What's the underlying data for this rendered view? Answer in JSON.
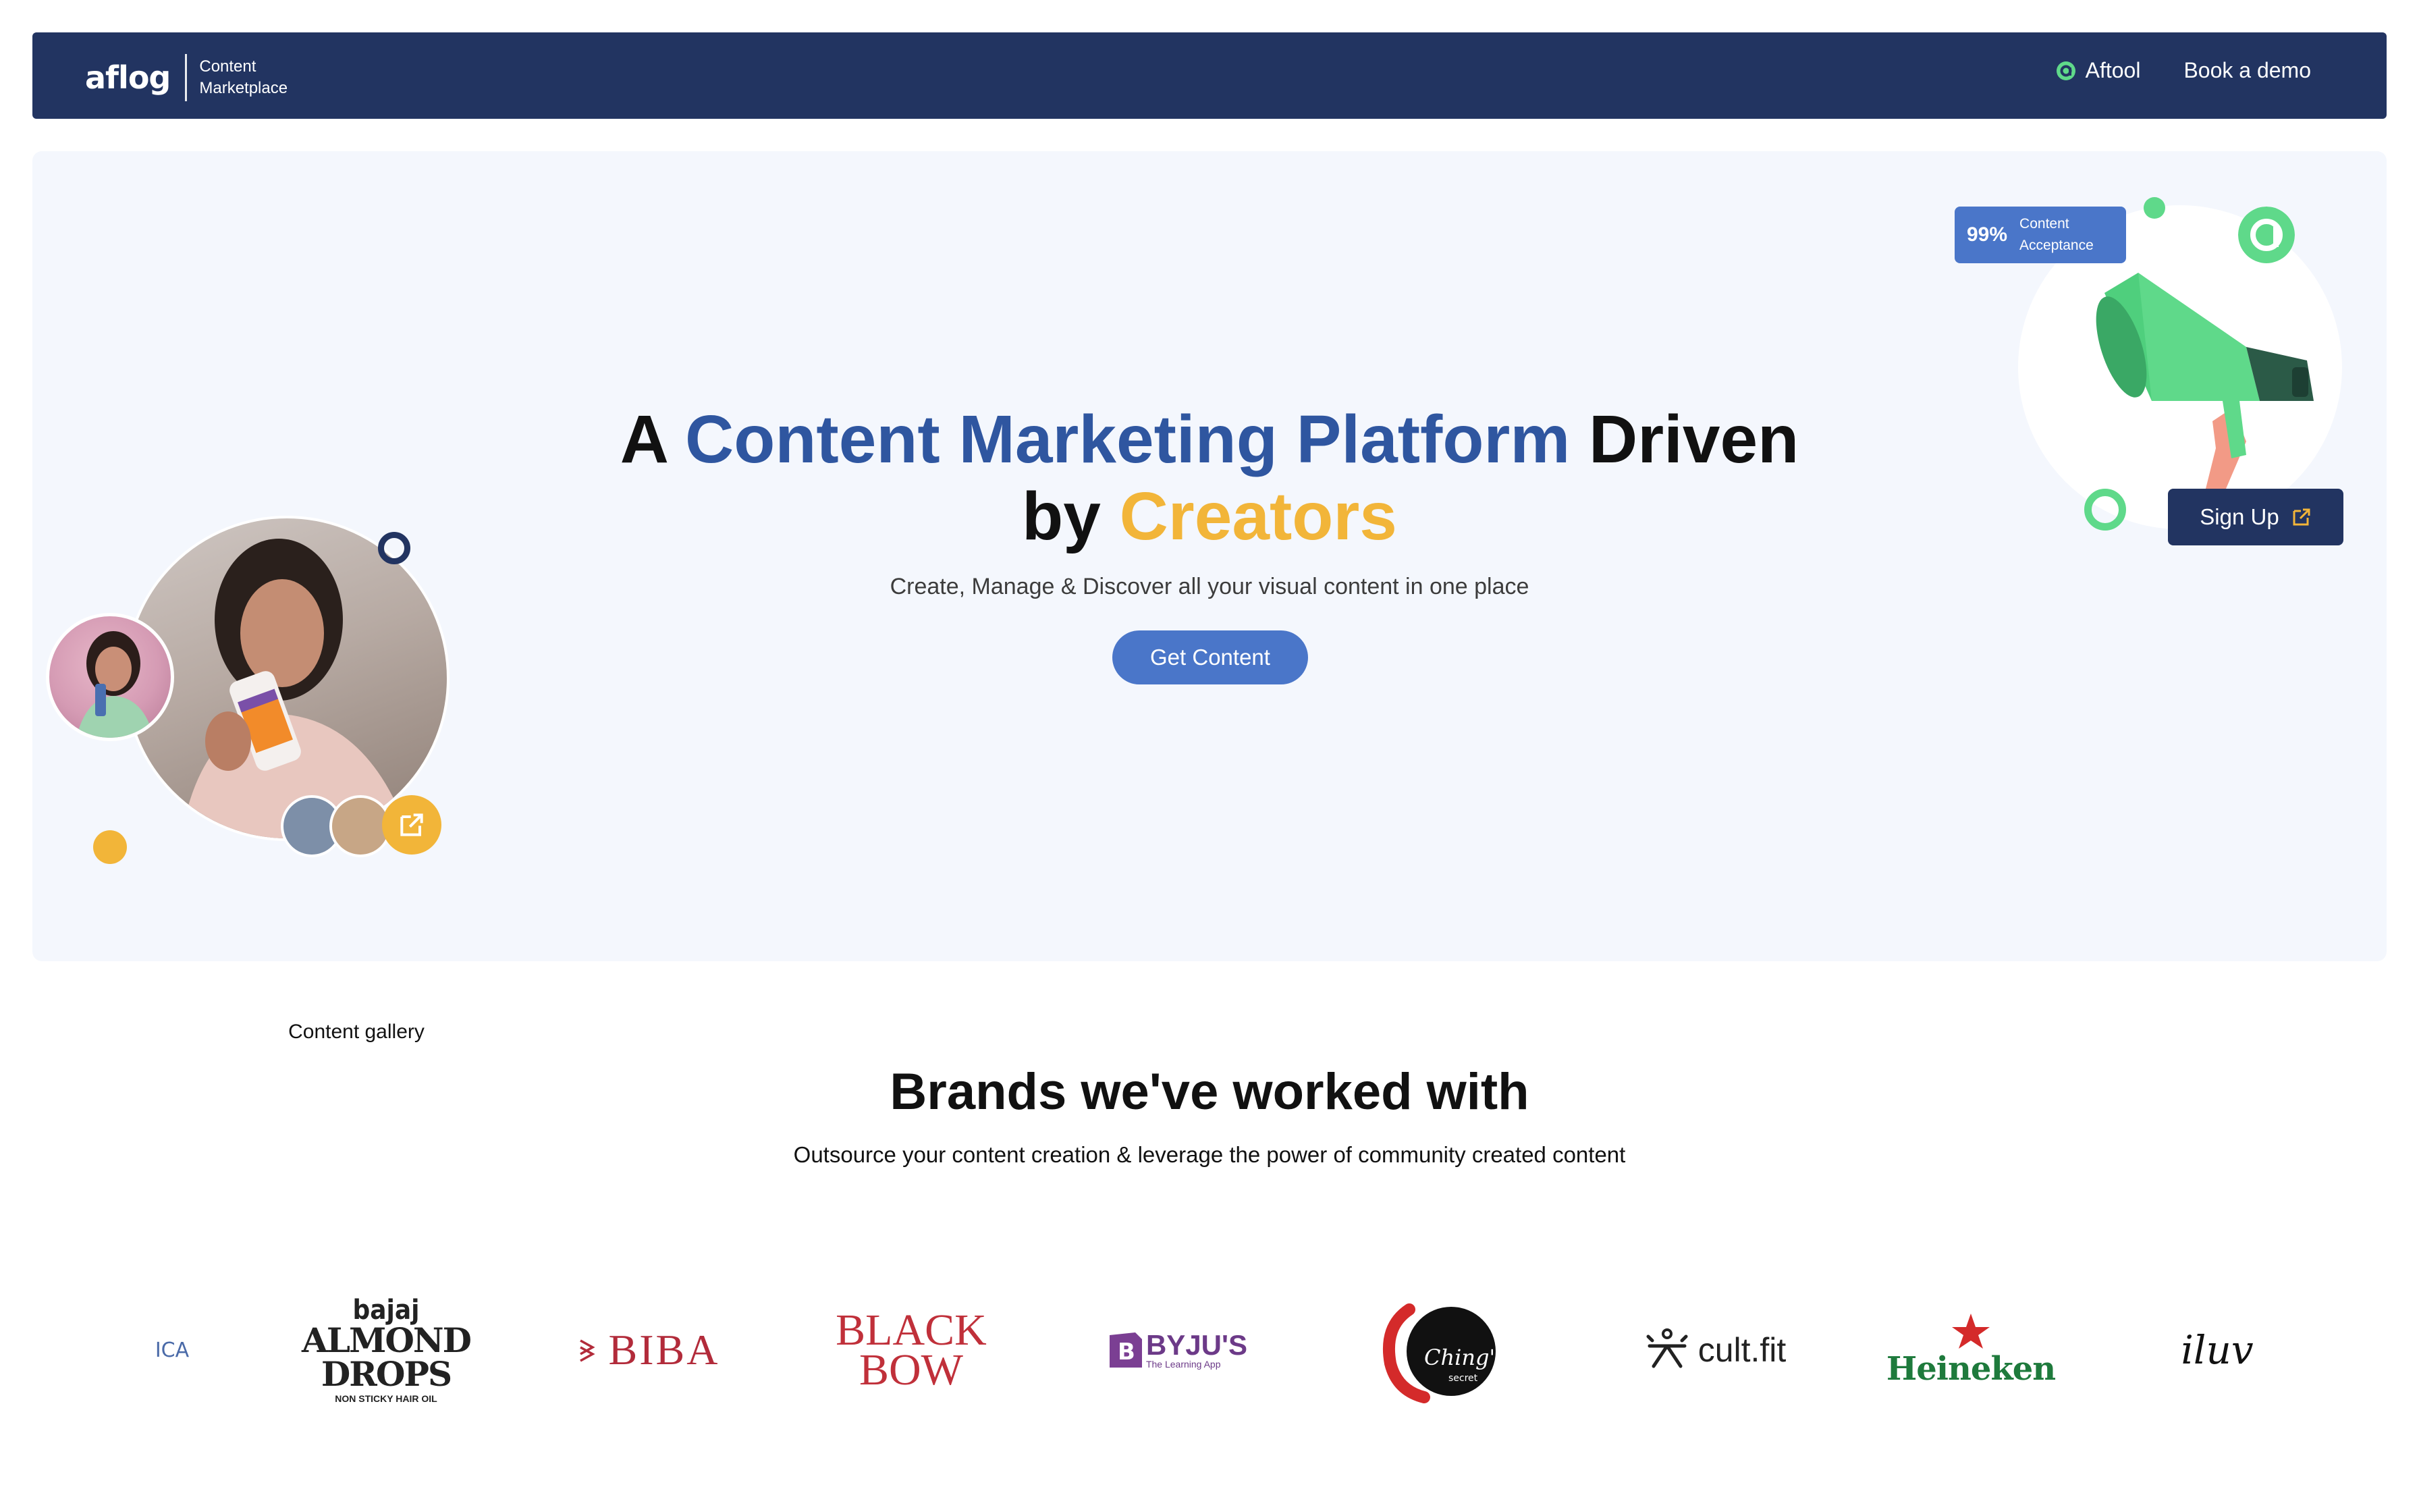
{
  "nav": {
    "logo": "aflog",
    "subtitle_line1": "Content",
    "subtitle_line2": "Marketplace",
    "links": [
      {
        "label": "Aftool",
        "icon": "aftool-icon"
      },
      {
        "label": "Book a demo"
      }
    ]
  },
  "hero": {
    "title": {
      "part1": "A ",
      "highlight": "Content Marketing Platform",
      "part2": " Driven",
      "part3": "by ",
      "highlight2": "Creators"
    },
    "subtitle": "Create, Manage & Discover all your visual content in one place",
    "cta_label": "Get Content",
    "acceptance": {
      "percent": "99%",
      "line1": "Content",
      "line2": "Acceptance"
    },
    "signup_label": "Sign Up",
    "gallery_label": "Content gallery",
    "colors": {
      "navy": "#223461",
      "blue": "#2f56a0",
      "gold": "#f2b539",
      "green": "#5fd98a",
      "accent": "#4a76c9"
    }
  },
  "brands": {
    "title": "Brands we've worked with",
    "subtitle": "Outsource your content creation & leverage the power of community created content",
    "logos": [
      {
        "name": "ICA",
        "text": "ICA"
      },
      {
        "name": "bajaj",
        "top": "bajaj",
        "line1": "ALMOND",
        "line2": "DROPS",
        "line3": "NON STICKY HAIR OIL"
      },
      {
        "name": "BIBA",
        "text": "BIBA"
      },
      {
        "name": "BLACK BOW",
        "line1": "BLACK",
        "line2": "BOW"
      },
      {
        "name": "BYJU'S",
        "text": "BYJU'S",
        "tagline": "The Learning App"
      },
      {
        "name": "Ching's",
        "text": "Ching's",
        "small": "secret"
      },
      {
        "name": "cult.fit",
        "text": "cult.fit"
      },
      {
        "name": "Heineken",
        "text": "Heineken"
      },
      {
        "name": "iluv",
        "text": "iluv"
      }
    ]
  }
}
